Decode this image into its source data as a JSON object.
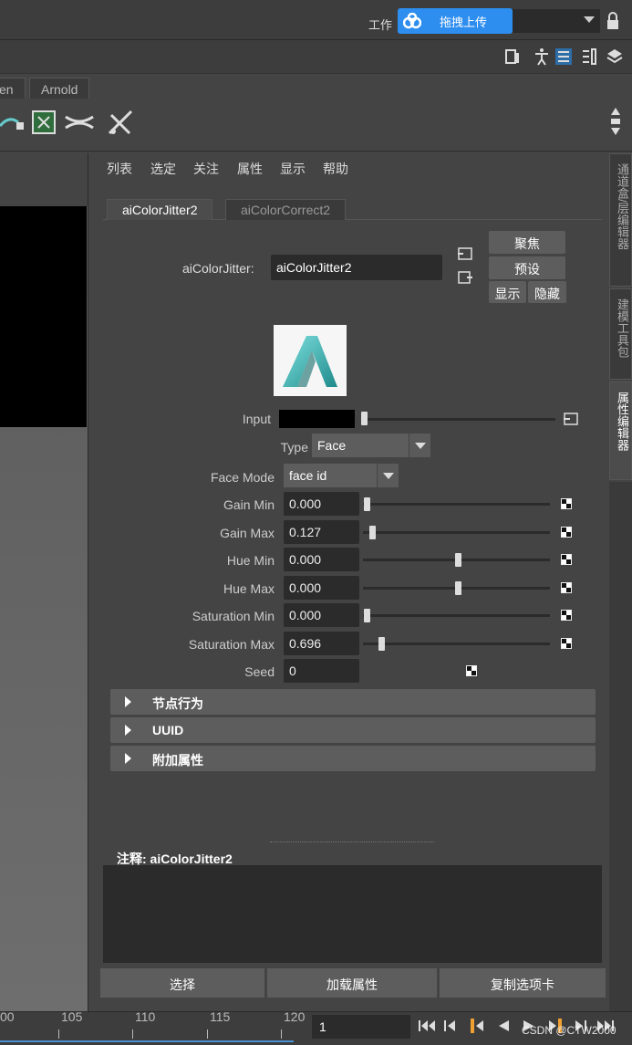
{
  "topbar": {
    "workspace_label": "工作",
    "upload_label": "拖拽上传"
  },
  "shelf_tabs": [
    "en",
    "Arnold"
  ],
  "menu": [
    "列表",
    "选定",
    "关注",
    "属性",
    "显示",
    "帮助"
  ],
  "node_tabs": [
    {
      "label": "aiColorJitter2",
      "active": true
    },
    {
      "label": "aiColorCorrect2",
      "active": false
    }
  ],
  "node": {
    "type_label": "aiColorJitter:",
    "name": "aiColorJitter2"
  },
  "buttons": {
    "focus": "聚焦",
    "presets": "预设",
    "show": "显示",
    "hide": "隐藏"
  },
  "attributes": {
    "input_label": "Input",
    "type_label": "Type",
    "type_value": "Face",
    "face_mode_label": "Face Mode",
    "face_mode_value": "face id",
    "gain_min": {
      "label": "Gain Min",
      "value": "0.000",
      "slider": 0.0
    },
    "gain_max": {
      "label": "Gain Max",
      "value": "0.127",
      "slider": 0.03
    },
    "hue_min": {
      "label": "Hue Min",
      "value": "0.000",
      "slider": 0.5
    },
    "hue_max": {
      "label": "Hue Max",
      "value": "0.000",
      "slider": 0.5
    },
    "sat_min": {
      "label": "Saturation Min",
      "value": "0.000",
      "slider": 0.0
    },
    "sat_max": {
      "label": "Saturation Max",
      "value": "0.696",
      "slider": 0.08
    },
    "seed": {
      "label": "Seed",
      "value": "0"
    }
  },
  "sections": [
    "节点行为",
    "UUID",
    "附加属性"
  ],
  "notes": {
    "label": "注释: aiColorJitter2"
  },
  "bottom_buttons": [
    "选择",
    "加载属性",
    "复制选项卡"
  ],
  "side_tabs": [
    "通道盒/层编辑器",
    "建模工具包",
    "属性编辑器"
  ],
  "timeline": {
    "ticks": [
      "00",
      "105",
      "110",
      "115",
      "120"
    ],
    "current_frame": "1"
  },
  "watermark": "CSDN @CTW2000",
  "colors": {
    "panel_bg": "#444444",
    "field_bg": "#2b2b2b",
    "button_bg": "#5d5d5d",
    "upload_accent": "#2d8ef0",
    "playhead": "#f0a030"
  }
}
